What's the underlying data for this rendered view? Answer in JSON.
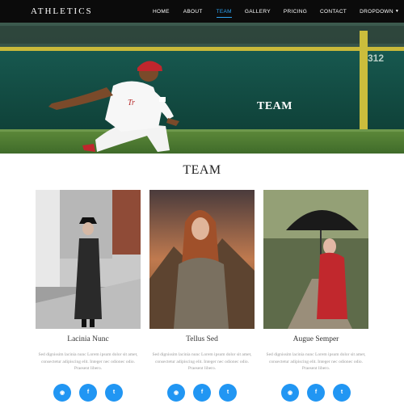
{
  "brand": "ATHLETICS",
  "nav": [
    "HOME",
    "ABOUT",
    "TEAM",
    "GALLERY",
    "PRICING",
    "CONTACT",
    "DROPDOWN"
  ],
  "active_nav": "TEAM",
  "banner": {
    "title": "TEAM"
  },
  "section": {
    "title": "TEAM"
  },
  "members": [
    {
      "name": "Lacinia Nunc",
      "desc": "Sed dignissim lacinia nunc Lorem ipsum dolor sit amet, consectetur adipiscing elit. Integer nec odionec odio. Praesent libero."
    },
    {
      "name": "Tellus Sed",
      "desc": "Sed dignissim lacinia nunc Lorem ipsum dolor sit amet, consectetur adipiscing elit. Integer nec odionec odio. Praesent libero."
    },
    {
      "name": "Augue Semper",
      "desc": "Sed dignissim lacinia nunc Lorem ipsum dolor sit amet, consectetur adipiscing elit. Integer nec odionec odio. Praesent libero."
    }
  ],
  "social_icons": [
    "rss-icon",
    "facebook-icon",
    "twitter-icon"
  ],
  "colors": {
    "navbar": "#0b0b0b",
    "accent": "#2ea3f2",
    "social": "#2196f3"
  }
}
